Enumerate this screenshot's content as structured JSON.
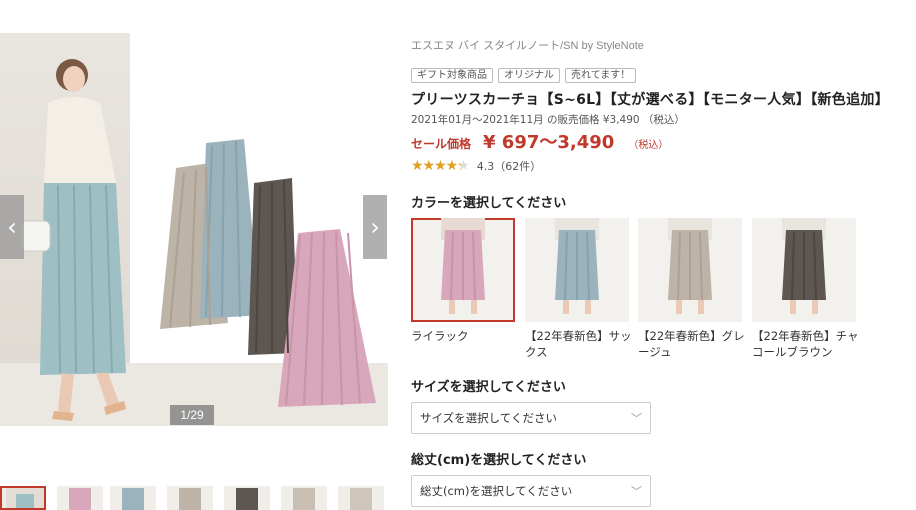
{
  "gallery": {
    "prev_icon": "chevron-left-icon",
    "next_icon": "chevron-right-icon",
    "prev_glyph": "‹",
    "next_glyph": "›",
    "counter": "1/29",
    "thumb_count": 7
  },
  "product": {
    "brand": "エスエヌ バイ スタイルノート/SN by StyleNote",
    "tags": [
      "ギフト対象商品",
      "オリジナル",
      "売れてます！"
    ],
    "title": "プリーツスカーチョ【S~6L】【丈が選べる】【モニター人気】【新色追加】",
    "period": "2021年01月～2021年11月 の販売価格 ¥3,490 （税込）",
    "sale_label": "セール価格",
    "sale_price": "¥ 697～3,490",
    "tax_label": "（税込）",
    "rating_value": 4.3,
    "rating_text": "4.3（62件）",
    "stars_glyph": "★★★★★"
  },
  "color_select": {
    "heading": "カラーを選択してください",
    "options": [
      {
        "label": "ライラック",
        "color": "#d8a7bb",
        "selected": true
      },
      {
        "label": "【22年春新色】サックス",
        "color": "#9bb3bd",
        "selected": false
      },
      {
        "label": "【22年春新色】グレージュ",
        "color": "#bdb3a6",
        "selected": false
      },
      {
        "label": "【22年春新色】チャコールブラウン",
        "color": "#5e5650",
        "selected": false
      }
    ]
  },
  "size_select": {
    "heading": "サイズを選択してください",
    "placeholder": "サイズを選択してください"
  },
  "length_select": {
    "heading": "総丈(cm)を選択してください",
    "placeholder": "総丈(cm)を選択してください"
  },
  "colors": {
    "accent": "#c0392b",
    "star": "#e0a020",
    "lilac": "#d8a7bb",
    "sax": "#9bb3bd",
    "greige": "#bdb3a6",
    "charcoal": "#5e5650"
  }
}
